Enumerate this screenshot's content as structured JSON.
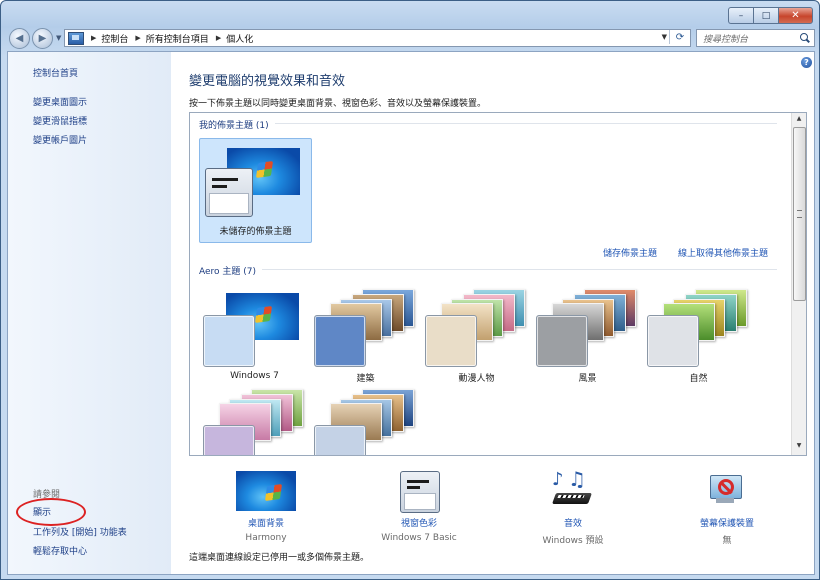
{
  "window": {
    "title": "",
    "controls": {
      "minimize": "–",
      "maximize": "□",
      "close": "✕"
    }
  },
  "navigation": {
    "back_icon": "back-arrow-icon",
    "forward_icon": "forward-arrow-icon",
    "breadcrumb": [
      "控制台",
      "所有控制台項目",
      "個人化"
    ],
    "search_placeholder": "搜尋控制台"
  },
  "sidebar": {
    "home_link": "控制台首頁",
    "links": [
      "變更桌面圖示",
      "變更滑鼠指標",
      "變更帳戶圖片"
    ],
    "see_also_title": "請參閱",
    "see_also": [
      "顯示",
      "工作列及 [開始] 功能表",
      "輕鬆存取中心"
    ],
    "highlight_color": "#dc2222"
  },
  "main": {
    "title": "變更電腦的視覺效果和音效",
    "description": "按一下佈景主題以同時變更桌面背景、視窗色彩、音效以及螢幕保護裝置。",
    "my_themes": {
      "title": "我的佈景主題 (1)",
      "items": [
        {
          "label": "未儲存的佈景主題",
          "selected": true
        }
      ],
      "save_link": "儲存佈景主題",
      "online_link": "線上取得其他佈景主題"
    },
    "aero_themes": {
      "title": "Aero 主題 (7)",
      "items": [
        {
          "label": "Windows 7",
          "swatch_color": "#c7dcf3"
        },
        {
          "label": "建築",
          "swatch_color": "#5f87c6"
        },
        {
          "label": "動漫人物",
          "swatch_color": "#e9ddc8"
        },
        {
          "label": "風景",
          "swatch_color": "#9c9fa3"
        },
        {
          "label": "自然",
          "swatch_color": "#dfe2e7"
        },
        {
          "label": "",
          "swatch_color": "#c6b6dd"
        },
        {
          "label": "",
          "swatch_color": "#c4d2e6"
        }
      ]
    },
    "bottom": [
      {
        "link": "桌面背景",
        "sub": "Harmony",
        "icon": "desktop-background-icon"
      },
      {
        "link": "視窗色彩",
        "sub": "Windows 7 Basic",
        "icon": "window-color-icon"
      },
      {
        "link": "音效",
        "sub": "Windows 預設",
        "icon": "sounds-icon"
      },
      {
        "link": "螢幕保護裝置",
        "sub": "無",
        "icon": "screen-saver-icon"
      }
    ],
    "note": "這端桌面連線設定已停用一或多個佈景主題。"
  }
}
